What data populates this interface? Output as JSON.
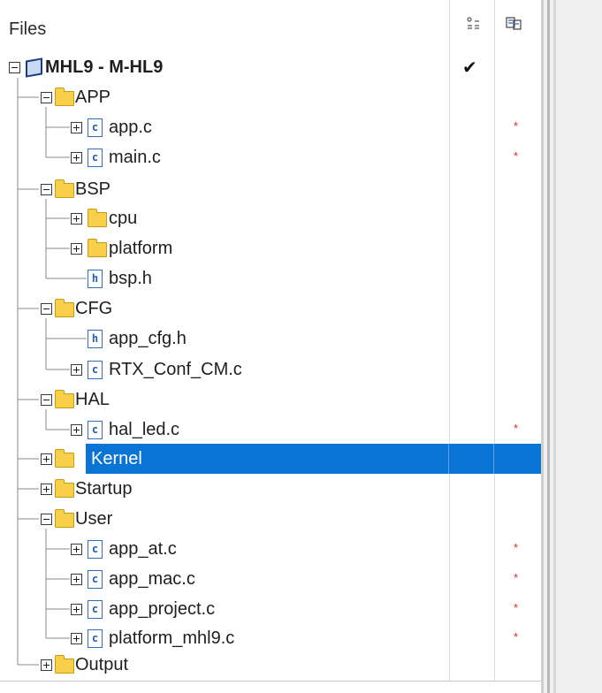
{
  "header": {
    "title": "Files",
    "col1_icon": "options-icon",
    "col2_icon": "build-icon"
  },
  "project": {
    "name": "MHL9 - M-HL9",
    "checked": true
  },
  "rows": [
    {
      "label": "APP",
      "type": "folder"
    },
    {
      "label": "app.c",
      "type": "c-file",
      "modified": true
    },
    {
      "label": "main.c",
      "type": "c-file",
      "modified": true
    },
    {
      "label": "BSP",
      "type": "folder"
    },
    {
      "label": "cpu",
      "type": "folder"
    },
    {
      "label": "platform",
      "type": "folder"
    },
    {
      "label": "bsp.h",
      "type": "h-file"
    },
    {
      "label": "CFG",
      "type": "folder"
    },
    {
      "label": "app_cfg.h",
      "type": "h-file"
    },
    {
      "label": "RTX_Conf_CM.c",
      "type": "c-file"
    },
    {
      "label": "HAL",
      "type": "folder"
    },
    {
      "label": "hal_led.c",
      "type": "c-file",
      "modified": true
    },
    {
      "label": "Kernel",
      "type": "folder",
      "selected": true
    },
    {
      "label": "Startup",
      "type": "folder"
    },
    {
      "label": "User",
      "type": "folder"
    },
    {
      "label": "app_at.c",
      "type": "c-file",
      "modified": true
    },
    {
      "label": "app_mac.c",
      "type": "c-file",
      "modified": true
    },
    {
      "label": "app_project.c",
      "type": "c-file",
      "modified": true
    },
    {
      "label": "platform_mhl9.c",
      "type": "c-file",
      "modified": true
    },
    {
      "label": "Output",
      "type": "folder"
    }
  ],
  "marks": {
    "check": "✔",
    "star": "*",
    "c_glyph": "c",
    "h_glyph": "h"
  },
  "colors": {
    "selection": "#0a74d4",
    "folder": "#f7cf48",
    "modified_star": "#d8262a"
  }
}
